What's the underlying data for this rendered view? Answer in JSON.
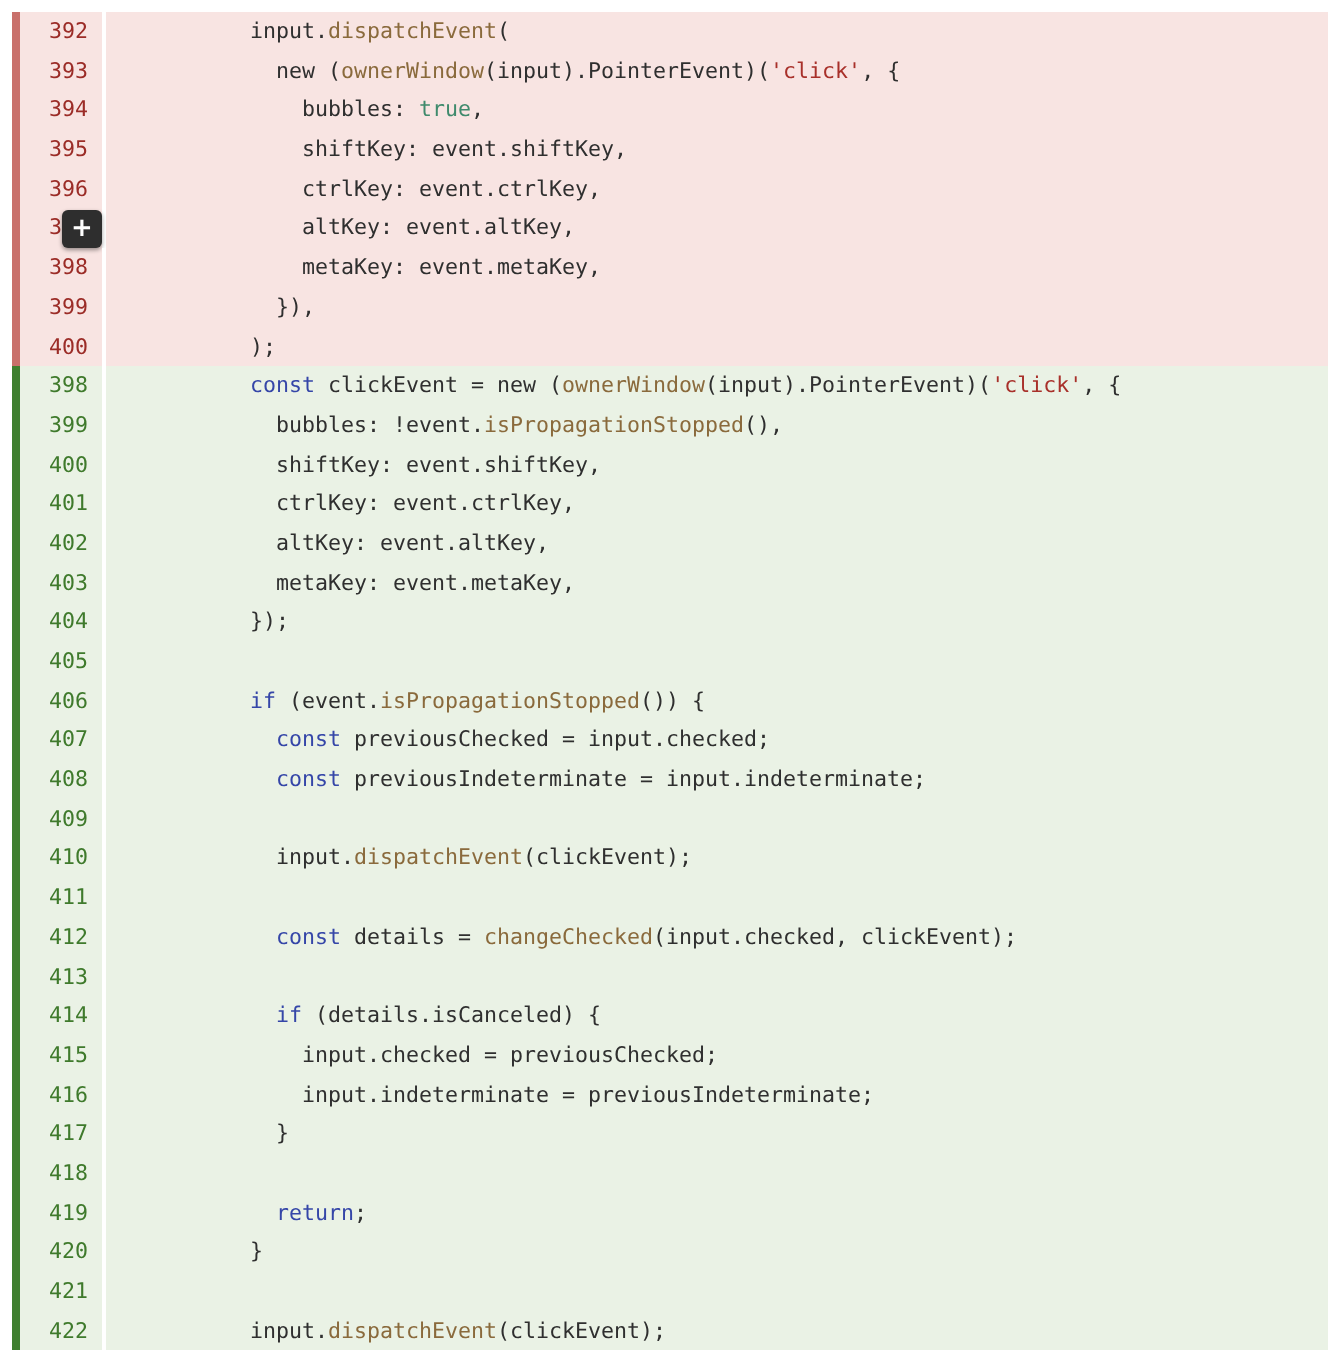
{
  "diff": {
    "lines": [
      {
        "kind": "removed",
        "number": "392",
        "code": [
          {
            "text": "input.",
            "kind": "plain"
          },
          {
            "text": "dispatchEvent",
            "kind": "method"
          },
          {
            "text": "(",
            "kind": "plain"
          }
        ]
      },
      {
        "kind": "removed",
        "number": "393",
        "code": [
          {
            "text": "  new (",
            "kind": "plain"
          },
          {
            "text": "ownerWindow",
            "kind": "method"
          },
          {
            "text": "(input).PointerEvent)(",
            "kind": "plain"
          },
          {
            "text": "'click'",
            "kind": "string"
          },
          {
            "text": ", {",
            "kind": "plain"
          }
        ]
      },
      {
        "kind": "removed",
        "number": "394",
        "code": [
          {
            "text": "    bubbles: ",
            "kind": "plain"
          },
          {
            "text": "true",
            "kind": "literal"
          },
          {
            "text": ",",
            "kind": "plain"
          }
        ]
      },
      {
        "kind": "removed",
        "number": "395",
        "code": [
          {
            "text": "    shiftKey: event.shiftKey,",
            "kind": "plain"
          }
        ]
      },
      {
        "kind": "removed",
        "number": "396",
        "code": [
          {
            "text": "    ctrlKey: event.ctrlKey,",
            "kind": "plain"
          }
        ]
      },
      {
        "kind": "removed",
        "number": "3",
        "comment_button": "+",
        "code": [
          {
            "text": "    altKey: event.altKey,",
            "kind": "plain"
          }
        ]
      },
      {
        "kind": "removed",
        "number": "398",
        "code": [
          {
            "text": "    metaKey: event.metaKey,",
            "kind": "plain"
          }
        ]
      },
      {
        "kind": "removed",
        "number": "399",
        "code": [
          {
            "text": "  }),",
            "kind": "plain"
          }
        ]
      },
      {
        "kind": "removed",
        "number": "400",
        "code": [
          {
            "text": ");",
            "kind": "plain"
          }
        ]
      },
      {
        "kind": "added",
        "number": "398",
        "code": [
          {
            "text": "const",
            "kind": "keyword"
          },
          {
            "text": " clickEvent = new (",
            "kind": "plain"
          },
          {
            "text": "ownerWindow",
            "kind": "method"
          },
          {
            "text": "(input).PointerEvent)(",
            "kind": "plain"
          },
          {
            "text": "'click'",
            "kind": "string"
          },
          {
            "text": ", {",
            "kind": "plain"
          }
        ]
      },
      {
        "kind": "added",
        "number": "399",
        "code": [
          {
            "text": "  bubbles: !event.",
            "kind": "plain"
          },
          {
            "text": "isPropagationStopped",
            "kind": "method"
          },
          {
            "text": "(),",
            "kind": "plain"
          }
        ]
      },
      {
        "kind": "added",
        "number": "400",
        "code": [
          {
            "text": "  shiftKey: event.shiftKey,",
            "kind": "plain"
          }
        ]
      },
      {
        "kind": "added",
        "number": "401",
        "code": [
          {
            "text": "  ctrlKey: event.ctrlKey,",
            "kind": "plain"
          }
        ]
      },
      {
        "kind": "added",
        "number": "402",
        "code": [
          {
            "text": "  altKey: event.altKey,",
            "kind": "plain"
          }
        ]
      },
      {
        "kind": "added",
        "number": "403",
        "code": [
          {
            "text": "  metaKey: event.metaKey,",
            "kind": "plain"
          }
        ]
      },
      {
        "kind": "added",
        "number": "404",
        "code": [
          {
            "text": "});",
            "kind": "plain"
          }
        ]
      },
      {
        "kind": "added",
        "number": "405"
      },
      {
        "kind": "added",
        "number": "406",
        "code": [
          {
            "text": "if",
            "kind": "keyword"
          },
          {
            "text": " (event.",
            "kind": "plain"
          },
          {
            "text": "isPropagationStopped",
            "kind": "method"
          },
          {
            "text": "()) {",
            "kind": "plain"
          }
        ]
      },
      {
        "kind": "added",
        "number": "407",
        "code": [
          {
            "text": "  const",
            "kind": "keyword"
          },
          {
            "text": " previousChecked = input.checked;",
            "kind": "plain"
          }
        ]
      },
      {
        "kind": "added",
        "number": "408",
        "code": [
          {
            "text": "  const",
            "kind": "keyword"
          },
          {
            "text": " previousIndeterminate = input.indeterminate;",
            "kind": "plain"
          }
        ]
      },
      {
        "kind": "added",
        "number": "409"
      },
      {
        "kind": "added",
        "number": "410",
        "code": [
          {
            "text": "  input.",
            "kind": "plain"
          },
          {
            "text": "dispatchEvent",
            "kind": "method"
          },
          {
            "text": "(clickEvent);",
            "kind": "plain"
          }
        ]
      },
      {
        "kind": "added",
        "number": "411"
      },
      {
        "kind": "added",
        "number": "412",
        "code": [
          {
            "text": "  const",
            "kind": "keyword"
          },
          {
            "text": " details = ",
            "kind": "plain"
          },
          {
            "text": "changeChecked",
            "kind": "method"
          },
          {
            "text": "(input.checked, clickEvent);",
            "kind": "plain"
          }
        ]
      },
      {
        "kind": "added",
        "number": "413"
      },
      {
        "kind": "added",
        "number": "414",
        "code": [
          {
            "text": "  if",
            "kind": "keyword"
          },
          {
            "text": " (details.isCanceled) {",
            "kind": "plain"
          }
        ]
      },
      {
        "kind": "added",
        "number": "415",
        "code": [
          {
            "text": "    input.checked = previousChecked;",
            "kind": "plain"
          }
        ]
      },
      {
        "kind": "added",
        "number": "416",
        "code": [
          {
            "text": "    input.indeterminate = previousIndeterminate;",
            "kind": "plain"
          }
        ]
      },
      {
        "kind": "added",
        "number": "417",
        "code": [
          {
            "text": "  }",
            "kind": "plain"
          }
        ]
      },
      {
        "kind": "added",
        "number": "418"
      },
      {
        "kind": "added",
        "number": "419",
        "code": [
          {
            "text": "  return",
            "kind": "keyword"
          },
          {
            "text": ";",
            "kind": "plain"
          }
        ]
      },
      {
        "kind": "added",
        "number": "420",
        "code": [
          {
            "text": "}",
            "kind": "plain"
          }
        ]
      },
      {
        "kind": "added",
        "number": "421"
      },
      {
        "kind": "added",
        "number": "422",
        "code": [
          {
            "text": "input.",
            "kind": "plain"
          },
          {
            "text": "dispatchEvent",
            "kind": "method"
          },
          {
            "text": "(clickEvent);",
            "kind": "plain"
          }
        ]
      }
    ]
  }
}
